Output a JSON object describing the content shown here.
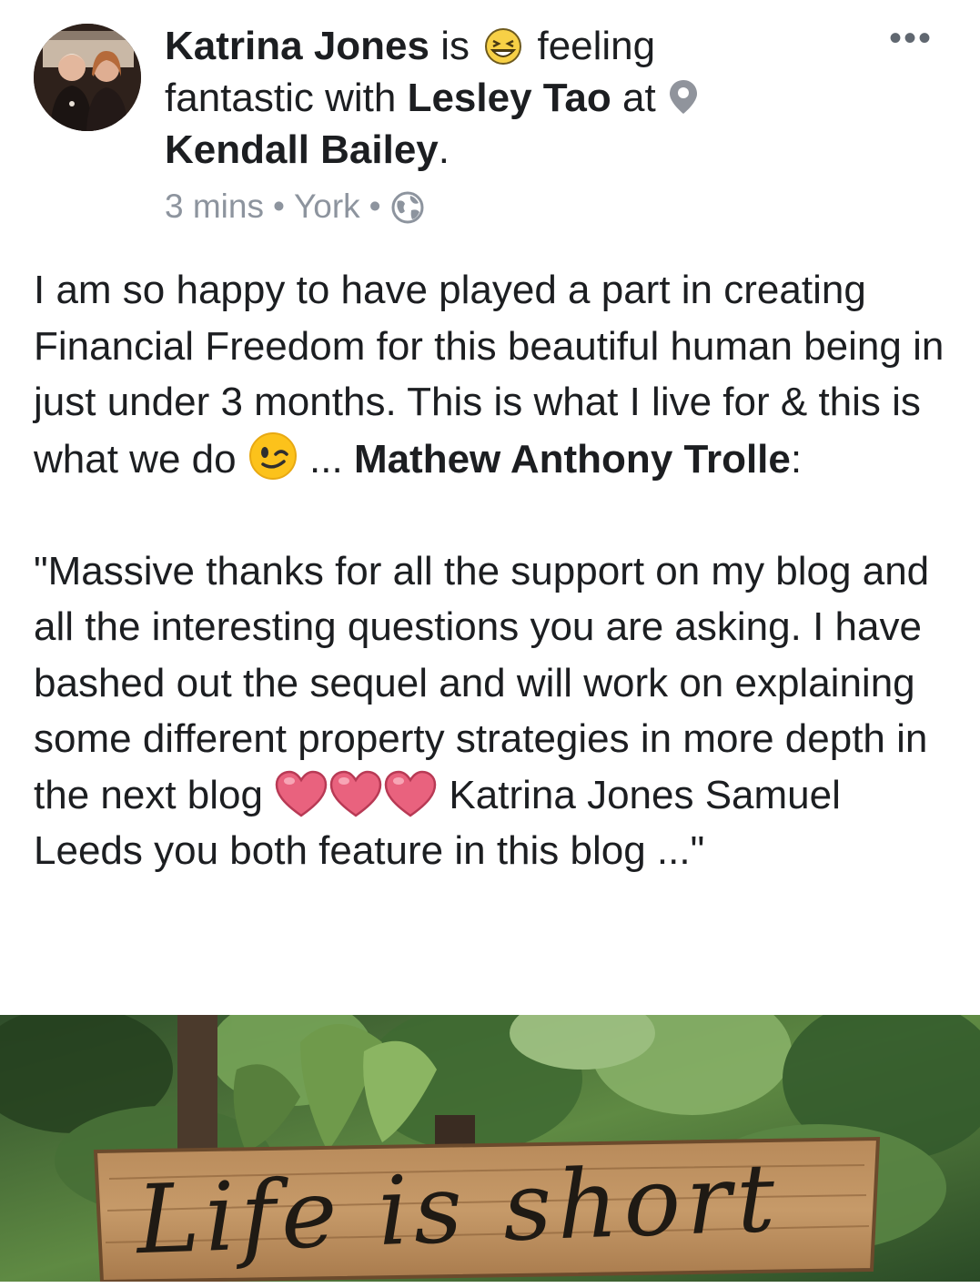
{
  "post": {
    "author": "Katrina Jones",
    "is_word": "is",
    "feeling_text": "feeling fantastic with",
    "tagged_person": "Lesley Tao",
    "at_word": "at",
    "location_name": "Kendall Bailey",
    "period": ".",
    "meta": {
      "time": "3 mins",
      "place": "York",
      "separator": "•",
      "privacy_icon": "globe-icon"
    },
    "more_label": "•••",
    "body": {
      "p1_text": "I am so happy to have played a part in creating Financial Freedom for this beautiful human being in just under 3 months. This is what I live for & this is what we do ",
      "p1_after_emoji": " ... ",
      "mention": "Mathew Anthony Trolle",
      "colon": ":",
      "quote_text": "\"Massive thanks for all the support on my blog and all the interesting questions you are asking. I have bashed out the sequel and will work on explaining some different property strategies in more depth in the next blog ",
      "quote_after_hearts": " Katrina Jones Samuel Leeds you both feature in this blog ...\""
    },
    "image_text": "Life is short"
  },
  "colors": {
    "text": "#1c1e21",
    "meta": "#8d949e",
    "heart": "#e0506e"
  }
}
